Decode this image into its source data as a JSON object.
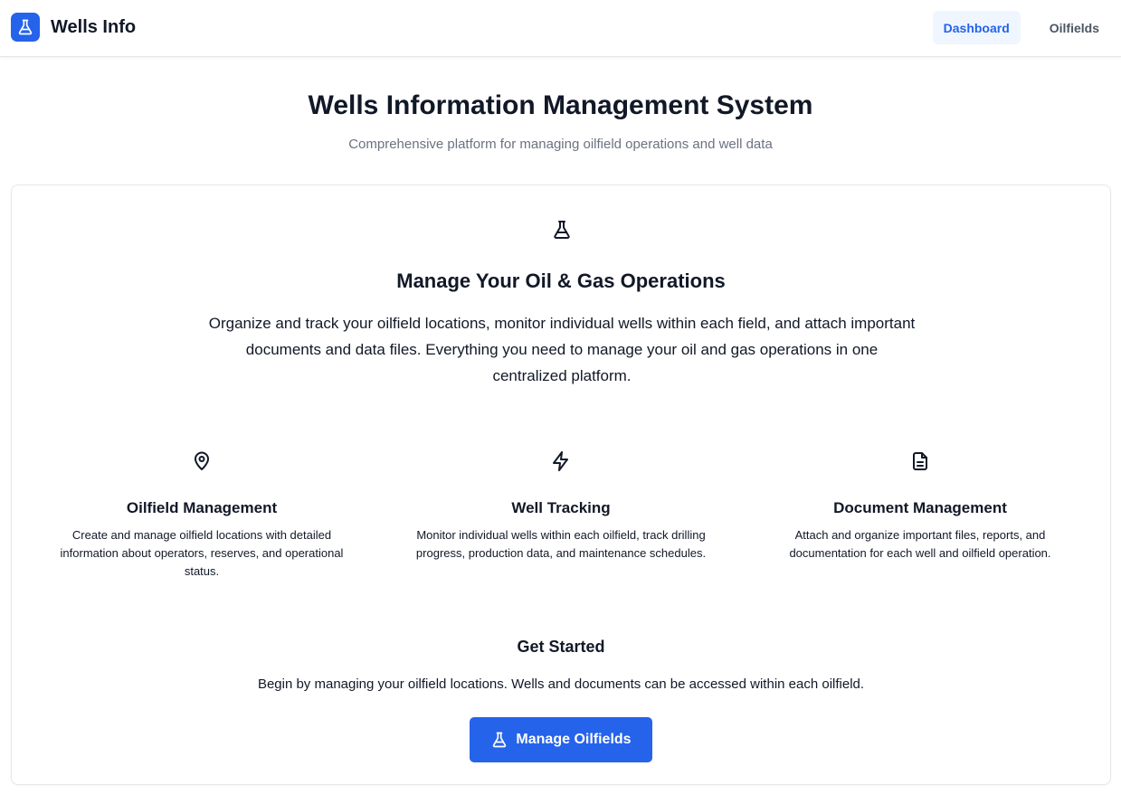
{
  "brand": {
    "name": "Wells Info",
    "accent": "#2563eb",
    "icon": "flask-icon"
  },
  "nav": {
    "items": [
      {
        "label": "Dashboard",
        "active": true
      },
      {
        "label": "Oilfields",
        "active": false
      }
    ]
  },
  "header": {
    "title": "Wells Information Management System",
    "subtitle": "Comprehensive platform for managing oilfield operations and well data"
  },
  "hero": {
    "icon": "flask-icon",
    "title": "Manage Your Oil & Gas Operations",
    "text": "Organize and track your oilfield locations, monitor individual wells within each field, and attach important documents and data files. Everything you need to manage your oil and gas operations in one centralized platform."
  },
  "features": [
    {
      "icon": "map-pin-icon",
      "title": "Oilfield Management",
      "text": "Create and manage oilfield locations with detailed information about operators, reserves, and operational status."
    },
    {
      "icon": "lightning-icon",
      "title": "Well Tracking",
      "text": "Monitor individual wells within each oilfield, track drilling progress, production data, and maintenance schedules."
    },
    {
      "icon": "document-icon",
      "title": "Document Management",
      "text": "Attach and organize important files, reports, and documentation for each well and oilfield operation."
    }
  ],
  "get_started": {
    "title": "Get Started",
    "text": "Begin by managing your oilfield locations. Wells and documents can be accessed within each oilfield.",
    "button_label": "Manage Oilfields",
    "button_icon": "flask-icon"
  }
}
